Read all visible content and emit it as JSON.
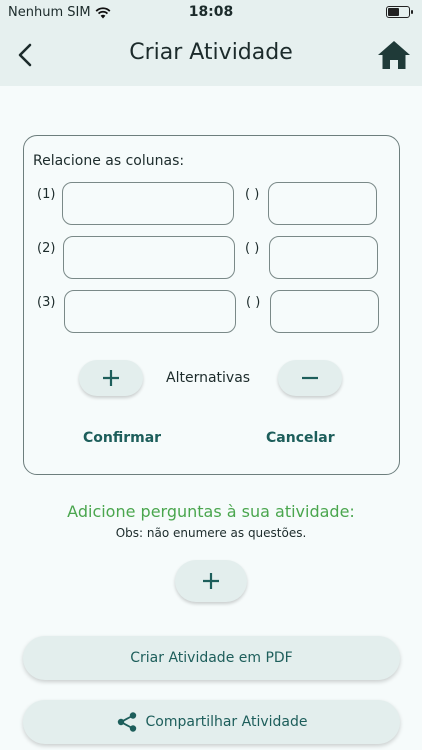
{
  "status": {
    "carrier": "Nenhum SIM",
    "time": "18:08"
  },
  "header": {
    "title": "Criar Atividade",
    "back_icon": "chevron-left-icon",
    "home_icon": "home-icon"
  },
  "card": {
    "instruction": "Relacione as colunas:",
    "rows": [
      {
        "left_label": "(1)",
        "right_label": "( )"
      },
      {
        "left_label": "(2)",
        "right_label": "( )"
      },
      {
        "left_label": "(3)",
        "right_label": "( )"
      }
    ],
    "alternatives_label": "Alternativas",
    "confirm_label": "Confirmar",
    "cancel_label": "Cancelar"
  },
  "questions": {
    "heading": "Adicione perguntas à sua atividade:",
    "note": "Obs: não enumere as questões."
  },
  "actions": {
    "pdf_label": "Criar Atividade em PDF",
    "share_label": "Compartilhar Atividade"
  },
  "colors": {
    "accent": "#1d5e5b",
    "heading_green": "#4aa64e",
    "app_bar": "#e6f0ef"
  }
}
